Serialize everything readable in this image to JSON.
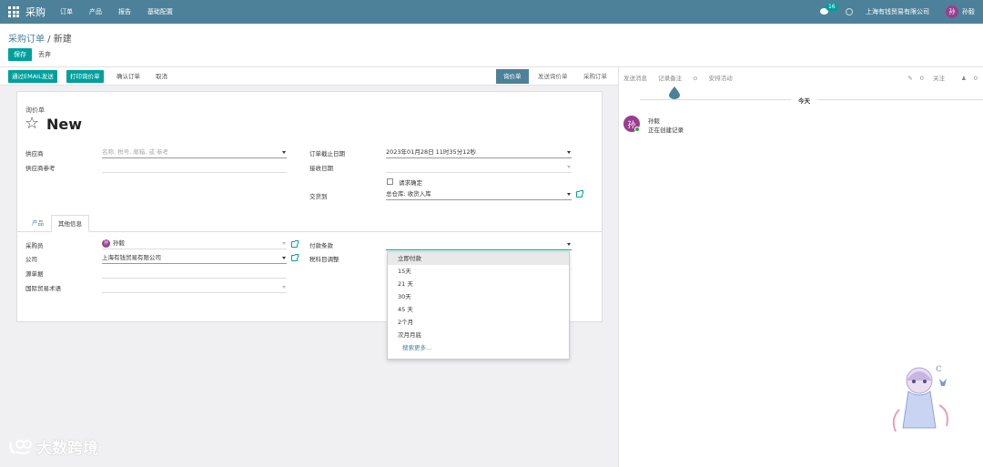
{
  "navbar": {
    "app_name": "采购",
    "menu": [
      "订单",
      "产品",
      "报告",
      "基础配置"
    ],
    "message_count": "16",
    "company": "上海有钱贸易有限公司",
    "user_initial": "孙",
    "user_name": "孙毅"
  },
  "breadcrumb": {
    "parent": "采购订单",
    "separator": " / ",
    "current": "新建"
  },
  "actions": {
    "save": "保存",
    "discard": "丢弃"
  },
  "statusbar": {
    "buttons": [
      "通过EMAIL发送",
      "打印询价单",
      "确认订单",
      "取消"
    ],
    "stages": [
      "询价单",
      "发送询价单",
      "采购订单"
    ],
    "active_stage": "询价单"
  },
  "form": {
    "doc_type": "询价单",
    "title": "New",
    "vendor_label": "供应商",
    "vendor_placeholder": "名称, 税号, 邮箱, 或 参考",
    "vendor_ref_label": "供应商参考",
    "order_deadline_label": "订单截止日期",
    "order_deadline_value": "2023年01月28日 11时35分12秒",
    "receipt_date_label": "接收日期",
    "ask_confirm_label": "请求确定",
    "deliver_to_label": "交货到",
    "deliver_to_value": "总仓库: 收货入库",
    "tabs": [
      "产品",
      "其他信息"
    ],
    "active_tab": "其他信息",
    "buyer_label": "采购员",
    "buyer_initial": "孙",
    "buyer_value": "孙毅",
    "company_label": "公司",
    "company_value": "上海有钱贸易有限公司",
    "source_doc_label": "源单据",
    "incoterm_label": "国际贸易术语",
    "payment_terms_label": "付款条款",
    "fiscal_position_label": "税科目调整"
  },
  "payment_dropdown": {
    "options": [
      "立即付款",
      "15天",
      "21 天",
      "30天",
      "45 天",
      "2个月",
      "次月月底"
    ],
    "highlighted": "立即付款",
    "search_more": "搜索更多..."
  },
  "chatter": {
    "send_message": "发送消息",
    "log_note": "记录备注",
    "schedule_activity": "安排活动",
    "attachments_count": "0",
    "follow": "关注",
    "followers_count": "0",
    "today": "今天",
    "author_initial": "孙",
    "author": "孙毅",
    "message": "正在创建记录"
  },
  "watermark": {
    "text": "大数跨境"
  },
  "colors": {
    "navbar": "#4d8199",
    "primary": "#00a09d",
    "avatar": "#9b3d8f"
  }
}
